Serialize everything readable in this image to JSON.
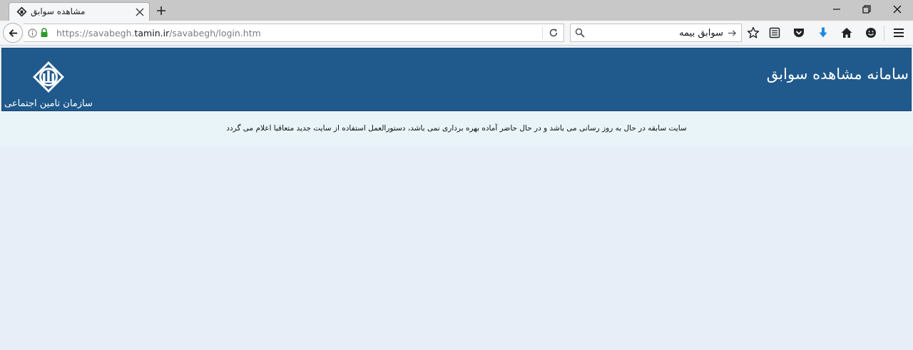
{
  "browser": {
    "tab": {
      "title": "مشاهده سوابق",
      "favicon": "tamin-logo-icon"
    },
    "address_bar": {
      "protocol": "https://",
      "host_prefix": "savabegh.",
      "host_domain": "tamin.ir",
      "path": "/savabegh/login.htm"
    },
    "search": {
      "value": "سوابق بیمه",
      "placeholder": ""
    },
    "toolbar_icons": [
      "bookmark-star-icon",
      "reading-list-icon",
      "pocket-icon",
      "download-icon",
      "home-icon",
      "smiley-icon",
      "menu-icon"
    ],
    "window_controls": [
      "minimize-icon",
      "restore-icon",
      "close-icon"
    ]
  },
  "page": {
    "banner": {
      "title": "سامانه مشاهده سوابق",
      "org_name": "سازمان تامین اجتماعی",
      "bg_color": "#205a8c"
    },
    "notice": "سایت سابقه در حال به روز رسانی می باشد و در حال حاضر آماده بهره برداری نمی باشد، دستورالعمل استفاده از سایت جدید متعاقبا اعلام می گردد"
  },
  "colors": {
    "accent_blue": "#205a8c",
    "page_bg": "#e8eef8",
    "download_blue": "#1e88e5"
  }
}
